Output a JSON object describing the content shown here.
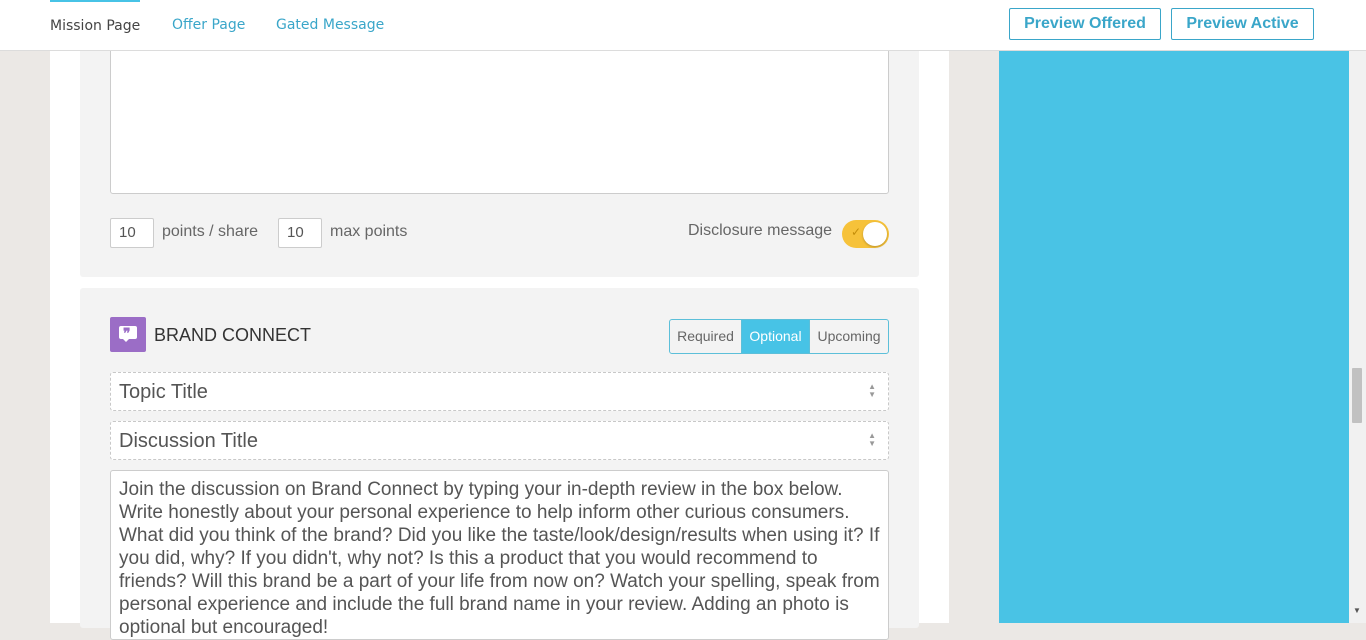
{
  "tabs": [
    {
      "label": "Mission Page",
      "active": true
    },
    {
      "label": "Offer Page",
      "active": false
    },
    {
      "label": "Gated Message",
      "active": false
    }
  ],
  "actions": {
    "preview_offered": "Preview Offered",
    "preview_active": "Preview Active"
  },
  "share": {
    "points_per_share": "10",
    "points_per_share_label": "points / share",
    "max_points": "10",
    "max_points_label": "max points",
    "disclosure_label": "Disclosure message",
    "disclosure_enabled": true
  },
  "brand_connect": {
    "title": "BRAND CONNECT",
    "icon": "chat-bubble-icon",
    "status_options": [
      "Required",
      "Optional",
      "Upcoming"
    ],
    "selected_status": "Optional",
    "topic_placeholder": "Topic Title",
    "discussion_placeholder": "Discussion Title",
    "instructions": "Join the discussion on Brand Connect by typing your in-depth review in the box below. Write honestly about your personal experience to help inform other curious consumers. What did you think of the brand? Did you like the taste/look/design/results when using it? If you did, why? If you didn't, why not? Is this a product that you would recommend to friends? Will this brand be a part of your life from now on? Watch your spelling, speak from personal experience and include the full brand name in your review. Adding an photo is optional but encouraged!"
  },
  "colors": {
    "accent": "#47c3e6",
    "toggle_on": "#f6c23a",
    "brand_icon": "#9b6dc6",
    "sidebar": "#49c3e5"
  }
}
